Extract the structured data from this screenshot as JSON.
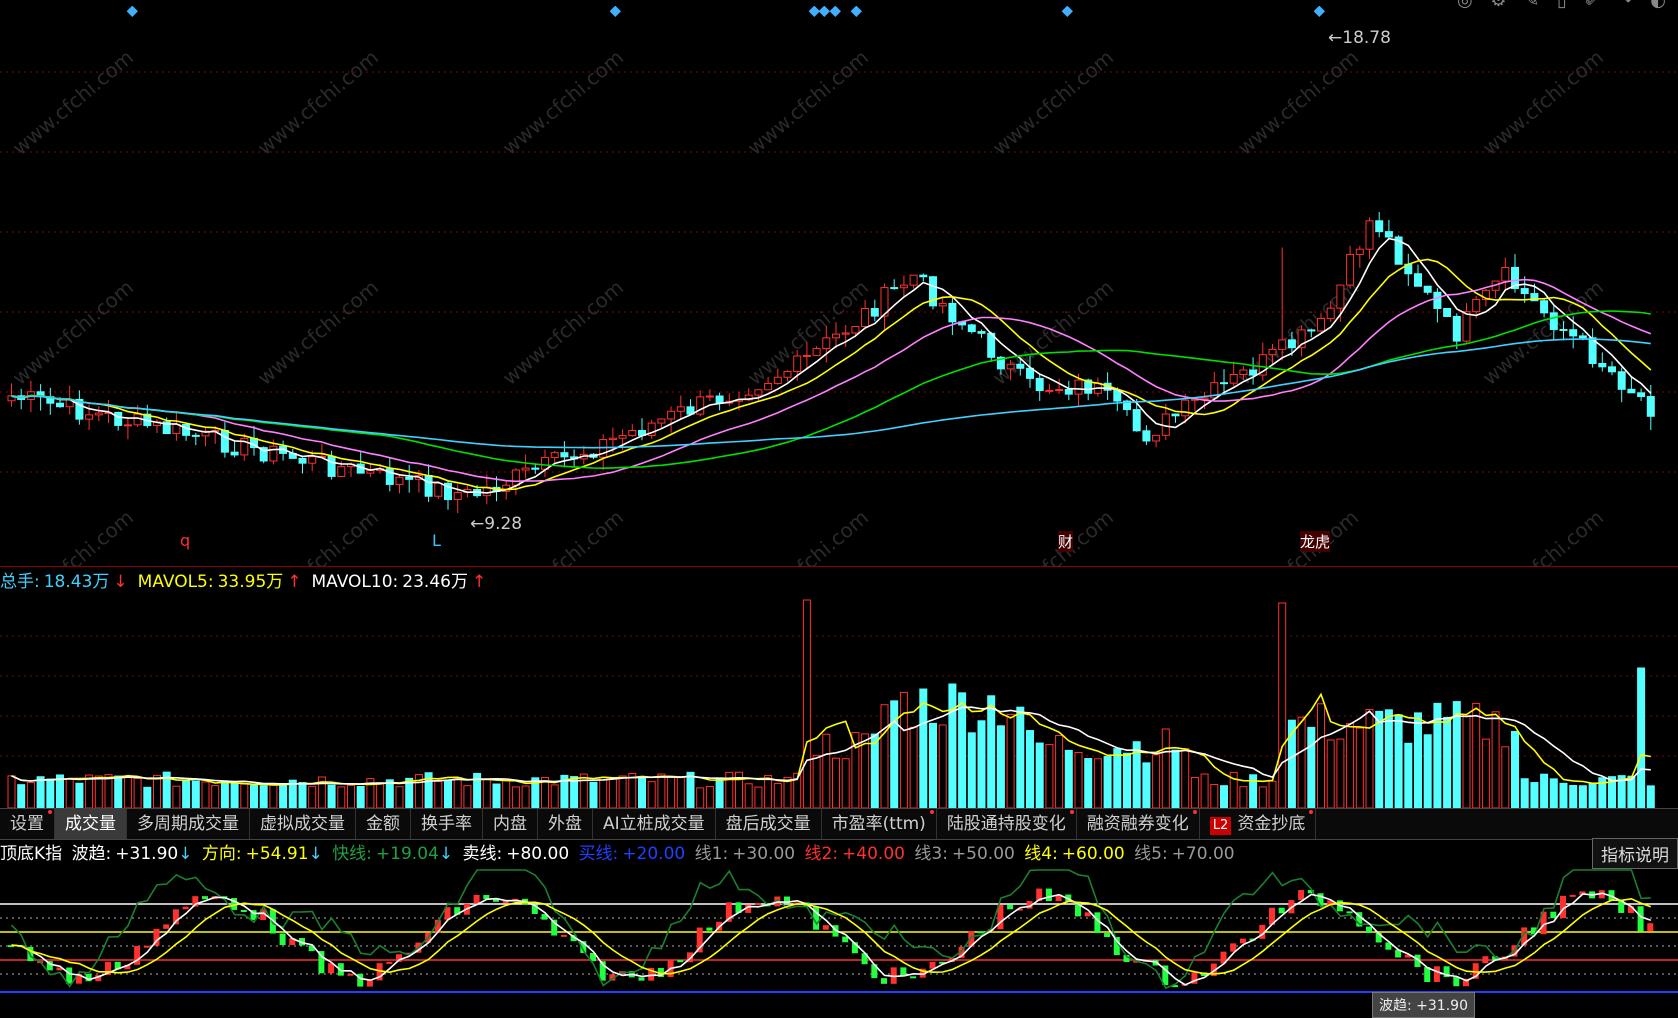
{
  "watermark": "www.cfchi.com",
  "main_chart": {
    "high_label": "18.78",
    "low_label": "9.28",
    "markers": [
      {
        "text": "q",
        "color": "#ff3030"
      },
      {
        "text": "L",
        "color": "#40c0ff"
      },
      {
        "text": "财",
        "color": "#ffffff"
      },
      {
        "text": "龙虎",
        "color": "#ffffff"
      }
    ]
  },
  "volume": {
    "total_label": "总手:",
    "total_value": "18.43万",
    "total_arrow": "↓",
    "mavol5_label": "MAVOL5:",
    "mavol5_value": "33.95万",
    "mavol5_arrow": "↑",
    "mavol10_label": "MAVOL10:",
    "mavol10_value": "23.46万",
    "mavol10_arrow": "↑"
  },
  "tabs": [
    {
      "label": "设置"
    },
    {
      "label": "成交量",
      "active": true
    },
    {
      "label": "多周期成交量"
    },
    {
      "label": "虚拟成交量"
    },
    {
      "label": "金额"
    },
    {
      "label": "换手率"
    },
    {
      "label": "内盘"
    },
    {
      "label": "外盘"
    },
    {
      "label": "AI立桩成交量"
    },
    {
      "label": "盘后成交量"
    },
    {
      "label": "市盈率(ttm)"
    },
    {
      "label": "陆股通持股变化"
    },
    {
      "label": "融资融券变化"
    },
    {
      "label": "资金抄底",
      "badge": "L2"
    }
  ],
  "indicator": {
    "name": "顶底K指",
    "bq_label": "波趋:",
    "bq_value": "+31.90",
    "bq_arrow": "↓",
    "fx_label": "方向:",
    "fx_value": "+54.91",
    "fx_arrow": "↓",
    "kx_label": "快线:",
    "kx_value": "+19.04",
    "kx_arrow": "↓",
    "mx_label": "卖线:",
    "mx_value": "+80.00",
    "bx_label": "买线:",
    "bx_value": "+20.00",
    "x1_label": "线1:",
    "x1_value": "+30.00",
    "x2_label": "线2:",
    "x2_value": "+40.00",
    "x3_label": "线3:",
    "x3_value": "+50.00",
    "x4_label": "线4:",
    "x4_value": "+60.00",
    "x5_label": "线5:",
    "x5_value": "+70.00",
    "explain_button": "指标说明",
    "tooltip": "波趋: +31.90"
  },
  "colors": {
    "up": "#ff3030",
    "down": "#54ffff",
    "ma5": "#ffffff",
    "ma10": "#ffff00",
    "ma20": "#ff80ff",
    "ma60": "#00e000",
    "ma120": "#40d0ff",
    "grid": "#8b0000"
  }
}
